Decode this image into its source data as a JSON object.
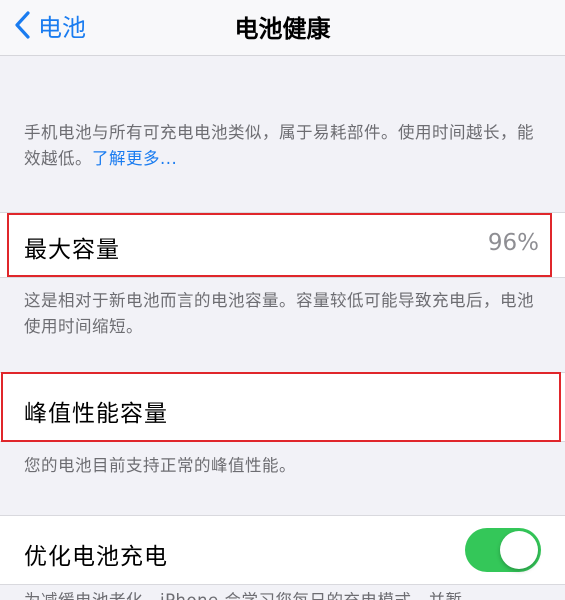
{
  "navbar": {
    "back_label": "电池",
    "title": "电池健康"
  },
  "intro": {
    "text": "手机电池与所有可充电电池类似，属于易耗部件。使用时间越长，能效越低。",
    "link_label": "了解更多..."
  },
  "max_capacity": {
    "label": "最大容量",
    "value": "96%",
    "footer": "这是相对于新电池而言的电池容量。容量较低可能导致充电后，电池使用时间缩短。"
  },
  "peak_performance": {
    "label": "峰值性能容量",
    "footer": "您的电池目前支持正常的峰值性能。"
  },
  "optimized_charging": {
    "label": "优化电池充电",
    "enabled": true,
    "footer_partial": "为减缓电池老化，iPhone 会学习您每日的充电模式，并暂"
  },
  "colors": {
    "accent": "#1a7cf0",
    "toggle_on": "#34c759",
    "highlight": "#e0262b"
  }
}
